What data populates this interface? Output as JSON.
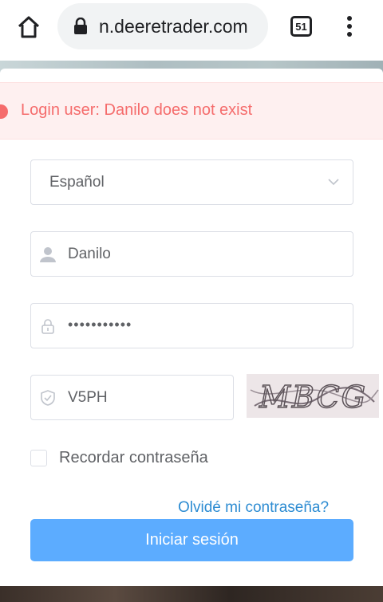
{
  "browser": {
    "url": "n.deeretrader.com",
    "tab_count": "51"
  },
  "alert": {
    "message": "Login user: Danilo does not exist",
    "color": "#f56c6c"
  },
  "form": {
    "language": "Español",
    "username": "Danilo",
    "password_masked": "•••••••••••",
    "captcha_value": "V5PH",
    "captcha_image_text": "MBCG",
    "remember_label": "Recordar contraseña",
    "forgot_label": "Olvidé mi contraseña?",
    "submit_label": "Iniciar sesión"
  },
  "colors": {
    "primary": "#409eff",
    "link": "#2d8cd2",
    "error": "#f56c6c"
  }
}
